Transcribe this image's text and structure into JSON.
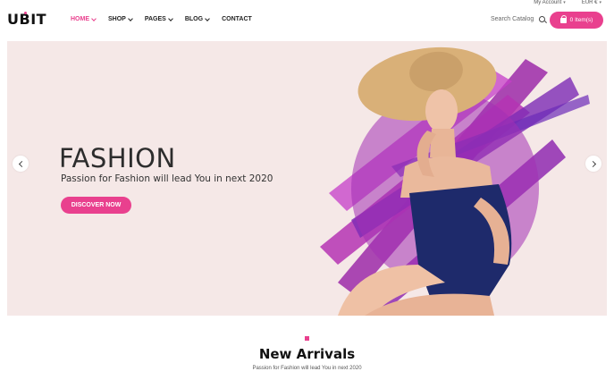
{
  "topbar": {
    "account": "My Account",
    "currency": "EUR €"
  },
  "brand": {
    "logo": "UBIT",
    "accent": "#e9408e",
    "hero_bg": "#f5e8e7"
  },
  "nav": {
    "home": "HOME",
    "shop": "SHOP",
    "pages": "PAGES",
    "blog": "BLOG",
    "contact": "CONTACT"
  },
  "search": {
    "label": "Search Catalog",
    "icon": "search-icon"
  },
  "cart": {
    "label": "0 Item(s)",
    "icon": "shopping-bag-icon"
  },
  "hero": {
    "title": "FASHION",
    "subtitle": "Passion for Fashion will lead You in next 2020",
    "cta": "DISCOVER NOW",
    "prev_icon": "chevron-left-icon",
    "next_icon": "chevron-right-icon"
  },
  "new_arrivals": {
    "title": "New Arrivals",
    "subtitle": "Passion for Fashion will lead You in next 2020"
  }
}
